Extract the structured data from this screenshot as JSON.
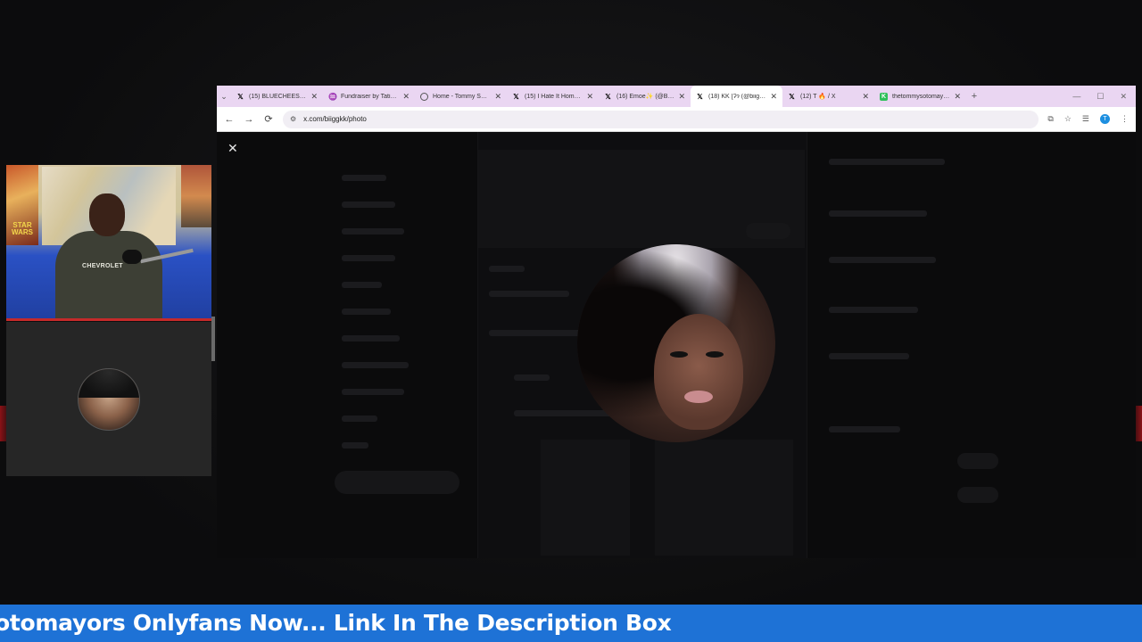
{
  "browser": {
    "tabs": [
      {
        "icon": "x-logo-icon",
        "title": "(15) BLUECHEESE M…",
        "active": false
      },
      {
        "icon": "fundraiser-icon",
        "title": "Fundraiser by Tatian…",
        "active": false
      },
      {
        "icon": "globe-icon",
        "title": "Home - Tommy Sot…",
        "active": false
      },
      {
        "icon": "x-logo-icon",
        "title": "(15) I Hate It Home…",
        "active": false
      },
      {
        "icon": "x-logo-icon",
        "title": "(16) Emoe✨ (@Bri…",
        "active": false
      },
      {
        "icon": "x-logo-icon",
        "title": "(18) KK [Ɂɂ (@biigk…",
        "active": true
      },
      {
        "icon": "x-logo-icon",
        "title": "(12) T 🔥 / X",
        "active": false
      },
      {
        "icon": "kick-icon",
        "title": "thetommysotomayor…",
        "active": false
      }
    ],
    "url": "x.com/biiggkk/photo",
    "profile_initial": "T"
  },
  "ticker": {
    "text": "otomayors Onlyfans Now... Link In The Description Box"
  },
  "webcam": {
    "poster_text": "STAR\nWARS",
    "shirt_text": "CHEVROLET"
  },
  "colors": {
    "tabstrip": "#ead6f2",
    "ticker": "#1e72d6",
    "guest_panel": "#262626"
  }
}
